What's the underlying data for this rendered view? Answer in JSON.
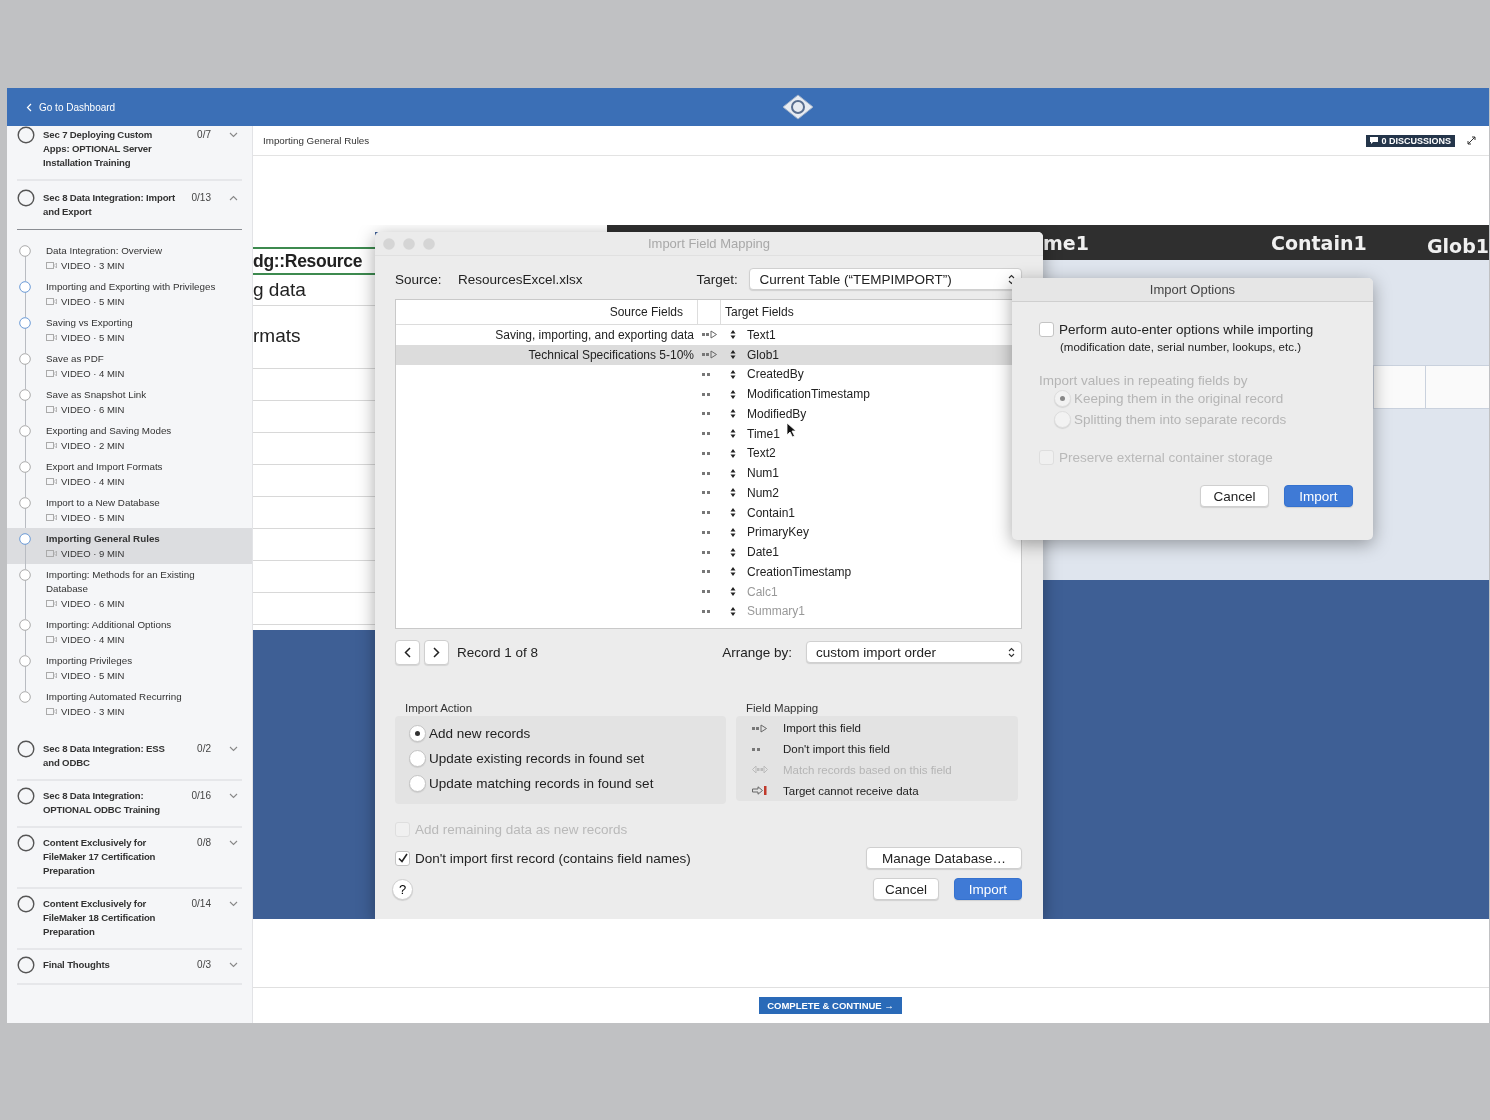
{
  "top_bar": {
    "back_link": "Go to Dashboard"
  },
  "sidebar": {
    "sections": [
      {
        "title": "Sec 7 Deploying Custom Apps: OPTIONAL Server Installation Training",
        "count": "0/7",
        "expanded": false
      },
      {
        "title": "Sec 8 Data Integration: Import and Export",
        "count": "0/13",
        "expanded": true,
        "lessons": [
          {
            "title": "Data Integration: Overview",
            "meta": "VIDEO · 3 MIN",
            "visited": false,
            "selected": false
          },
          {
            "title": "Importing and Exporting with Privileges",
            "meta": "VIDEO · 5 MIN",
            "visited": true,
            "selected": false
          },
          {
            "title": "Saving vs Exporting",
            "meta": "VIDEO · 5 MIN",
            "visited": true,
            "selected": false
          },
          {
            "title": "Save as PDF",
            "meta": "VIDEO · 4 MIN",
            "visited": false,
            "selected": false
          },
          {
            "title": "Save as Snapshot Link",
            "meta": "VIDEO · 6 MIN",
            "visited": false,
            "selected": false
          },
          {
            "title": "Exporting and Saving Modes",
            "meta": "VIDEO · 2 MIN",
            "visited": false,
            "selected": false
          },
          {
            "title": "Export and Import Formats",
            "meta": "VIDEO · 4 MIN",
            "visited": false,
            "selected": false
          },
          {
            "title": "Import to a New Database",
            "meta": "VIDEO · 5 MIN",
            "visited": false,
            "selected": false
          },
          {
            "title": "Importing General Rules",
            "meta": "VIDEO · 9 MIN",
            "visited": true,
            "selected": true
          },
          {
            "title": "Importing: Methods for an Existing Database",
            "meta": "VIDEO · 6 MIN",
            "visited": false,
            "selected": false
          },
          {
            "title": "Importing: Additional Options",
            "meta": "VIDEO · 4 MIN",
            "visited": false,
            "selected": false
          },
          {
            "title": "Importing Privileges",
            "meta": "VIDEO · 5 MIN",
            "visited": false,
            "selected": false
          },
          {
            "title": "Importing Automated Recurring",
            "meta": "VIDEO · 3 MIN",
            "visited": false,
            "selected": false
          }
        ]
      },
      {
        "title": "Sec 8 Data Integration: ESS and ODBC",
        "count": "0/2",
        "expanded": false
      },
      {
        "title": "Sec 8 Data Integration: OPTIONAL ODBC Training",
        "count": "0/16",
        "expanded": false
      },
      {
        "title": "Content Exclusively for FileMaker 17 Certification Preparation",
        "count": "0/8",
        "expanded": false
      },
      {
        "title": "Content Exclusively for FileMaker 18 Certification Preparation",
        "count": "0/14",
        "expanded": false
      },
      {
        "title": "Final Thoughts",
        "count": "0/3",
        "expanded": false
      }
    ]
  },
  "lesson_header": {
    "title": "Importing General Rules",
    "discussions": "0 DISCUSSIONS"
  },
  "video": {
    "layout": {
      "left_texts": [
        "dg::Resource",
        "g data",
        "rmats"
      ],
      "column_headers": [
        "me1",
        "Contain1",
        "Glob1"
      ]
    },
    "mapping_dialog": {
      "title": "Import Field Mapping",
      "source_label": "Source:",
      "source": "ResourcesExcel.xlsx",
      "target_label": "Target:",
      "target": "Current Table (“TEMPIMPORT”)",
      "columns": [
        "Source Fields",
        "Target Fields"
      ],
      "rows": [
        {
          "source": "Saving, importing, and exporting data",
          "kind": "import",
          "target": "Text1",
          "selected": false,
          "dimmed": false
        },
        {
          "source": "Technical Specifications 5-10%",
          "kind": "import",
          "target": "Glob1",
          "selected": true,
          "dimmed": false
        },
        {
          "kind": "skip",
          "target": "CreatedBy",
          "selected": false,
          "dimmed": false
        },
        {
          "kind": "skip",
          "target": "ModificationTimestamp",
          "selected": false,
          "dimmed": false
        },
        {
          "kind": "skip",
          "target": "ModifiedBy",
          "selected": false,
          "dimmed": false
        },
        {
          "kind": "skip",
          "target": "Time1",
          "selected": false,
          "dimmed": false
        },
        {
          "kind": "skip",
          "target": "Text2",
          "selected": false,
          "dimmed": false
        },
        {
          "kind": "skip",
          "target": "Num1",
          "selected": false,
          "dimmed": false
        },
        {
          "kind": "skip",
          "target": "Num2",
          "selected": false,
          "dimmed": false
        },
        {
          "kind": "skip",
          "target": "Contain1",
          "selected": false,
          "dimmed": false
        },
        {
          "kind": "skip",
          "target": "PrimaryKey",
          "selected": false,
          "dimmed": false
        },
        {
          "kind": "skip",
          "target": "Date1",
          "selected": false,
          "dimmed": false
        },
        {
          "kind": "skip",
          "target": "CreationTimestamp",
          "selected": false,
          "dimmed": false
        },
        {
          "kind": "skip",
          "target": "Calc1",
          "selected": false,
          "dimmed": true
        },
        {
          "kind": "skip",
          "target": "Summary1",
          "selected": false,
          "dimmed": true
        }
      ],
      "record": "Record 1 of 8",
      "arrange_label": "Arrange by:",
      "arrange": "custom import order",
      "import_action": {
        "title": "Import Action",
        "options": [
          {
            "label": "Add new records",
            "selected": true
          },
          {
            "label": "Update existing records in found set",
            "selected": false
          },
          {
            "label": "Update matching records in found set",
            "selected": false
          }
        ]
      },
      "field_mapping": {
        "title": "Field Mapping",
        "items": [
          {
            "kind": "import",
            "label": "Import this field",
            "disabled": false
          },
          {
            "kind": "skip",
            "label": "Don't import this field",
            "disabled": false
          },
          {
            "kind": "match",
            "label": "Match records based on this field",
            "disabled": true
          },
          {
            "kind": "blocked",
            "label": "Target cannot receive data",
            "disabled": false
          }
        ]
      },
      "add_remaining": {
        "label": "Add remaining data as new records",
        "checked": false,
        "disabled": true
      },
      "skip_first": {
        "label": "Don't import first record (contains field names)",
        "checked": true,
        "disabled": false
      },
      "manage_button": "Manage Database…",
      "help_button": "?",
      "cancel_button": "Cancel",
      "import_button": "Import"
    },
    "options_dialog": {
      "title": "Import Options",
      "auto_enter": {
        "label": "Perform auto-enter options while importing",
        "note": "(modification date, serial number, lookups, etc.)",
        "checked": false,
        "disabled": false
      },
      "repeating": {
        "label": "Import values in repeating fields by",
        "disabled": true,
        "options": [
          {
            "label": "Keeping them in the original record",
            "selected": true
          },
          {
            "label": "Splitting them into separate records",
            "selected": false
          }
        ]
      },
      "preserve": {
        "label": "Preserve external container storage",
        "checked": false,
        "disabled": true
      },
      "cancel_button": "Cancel",
      "import_button": "Import"
    }
  },
  "footer": {
    "button": "COMPLETE & CONTINUE →"
  }
}
